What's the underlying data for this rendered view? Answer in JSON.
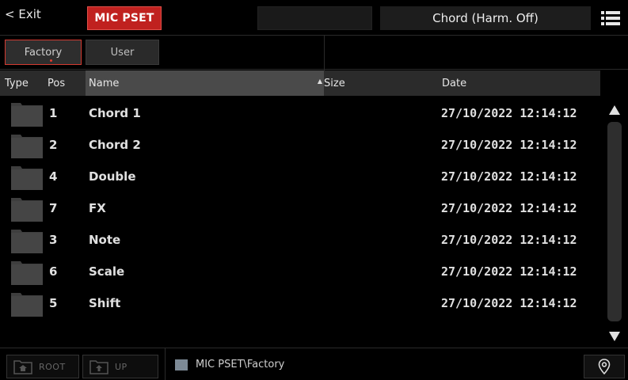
{
  "topbar": {
    "exit_label": "< Exit",
    "mode_label": "MIC PSET",
    "preset_name": "Chord (Harm. Off)",
    "accent_color": "#c0211f"
  },
  "tabs": [
    {
      "label": "Factory",
      "selected": true
    },
    {
      "label": "User",
      "selected": false
    }
  ],
  "columns": {
    "type": "Type",
    "pos": "Pos",
    "name": "Name",
    "size": "Size",
    "date": "Date"
  },
  "rows": [
    {
      "icon": "folder-icon",
      "pos": "1",
      "name": "Chord 1",
      "date": "27/10/2022 12:14:12"
    },
    {
      "icon": "folder-icon",
      "pos": "2",
      "name": "Chord 2",
      "date": "27/10/2022 12:14:12"
    },
    {
      "icon": "folder-icon",
      "pos": "4",
      "name": "Double",
      "date": "27/10/2022 12:14:12"
    },
    {
      "icon": "folder-icon",
      "pos": "7",
      "name": "FX",
      "date": "27/10/2022 12:14:12"
    },
    {
      "icon": "folder-icon",
      "pos": "3",
      "name": "Note",
      "date": "27/10/2022 12:14:12"
    },
    {
      "icon": "folder-icon",
      "pos": "6",
      "name": "Scale",
      "date": "27/10/2022 12:14:12"
    },
    {
      "icon": "folder-icon",
      "pos": "5",
      "name": "Shift",
      "date": "27/10/2022 12:14:12"
    }
  ],
  "bottombar": {
    "root_label": "ROOT",
    "up_label": "UP",
    "path": "MIC PSET\\Factory"
  }
}
